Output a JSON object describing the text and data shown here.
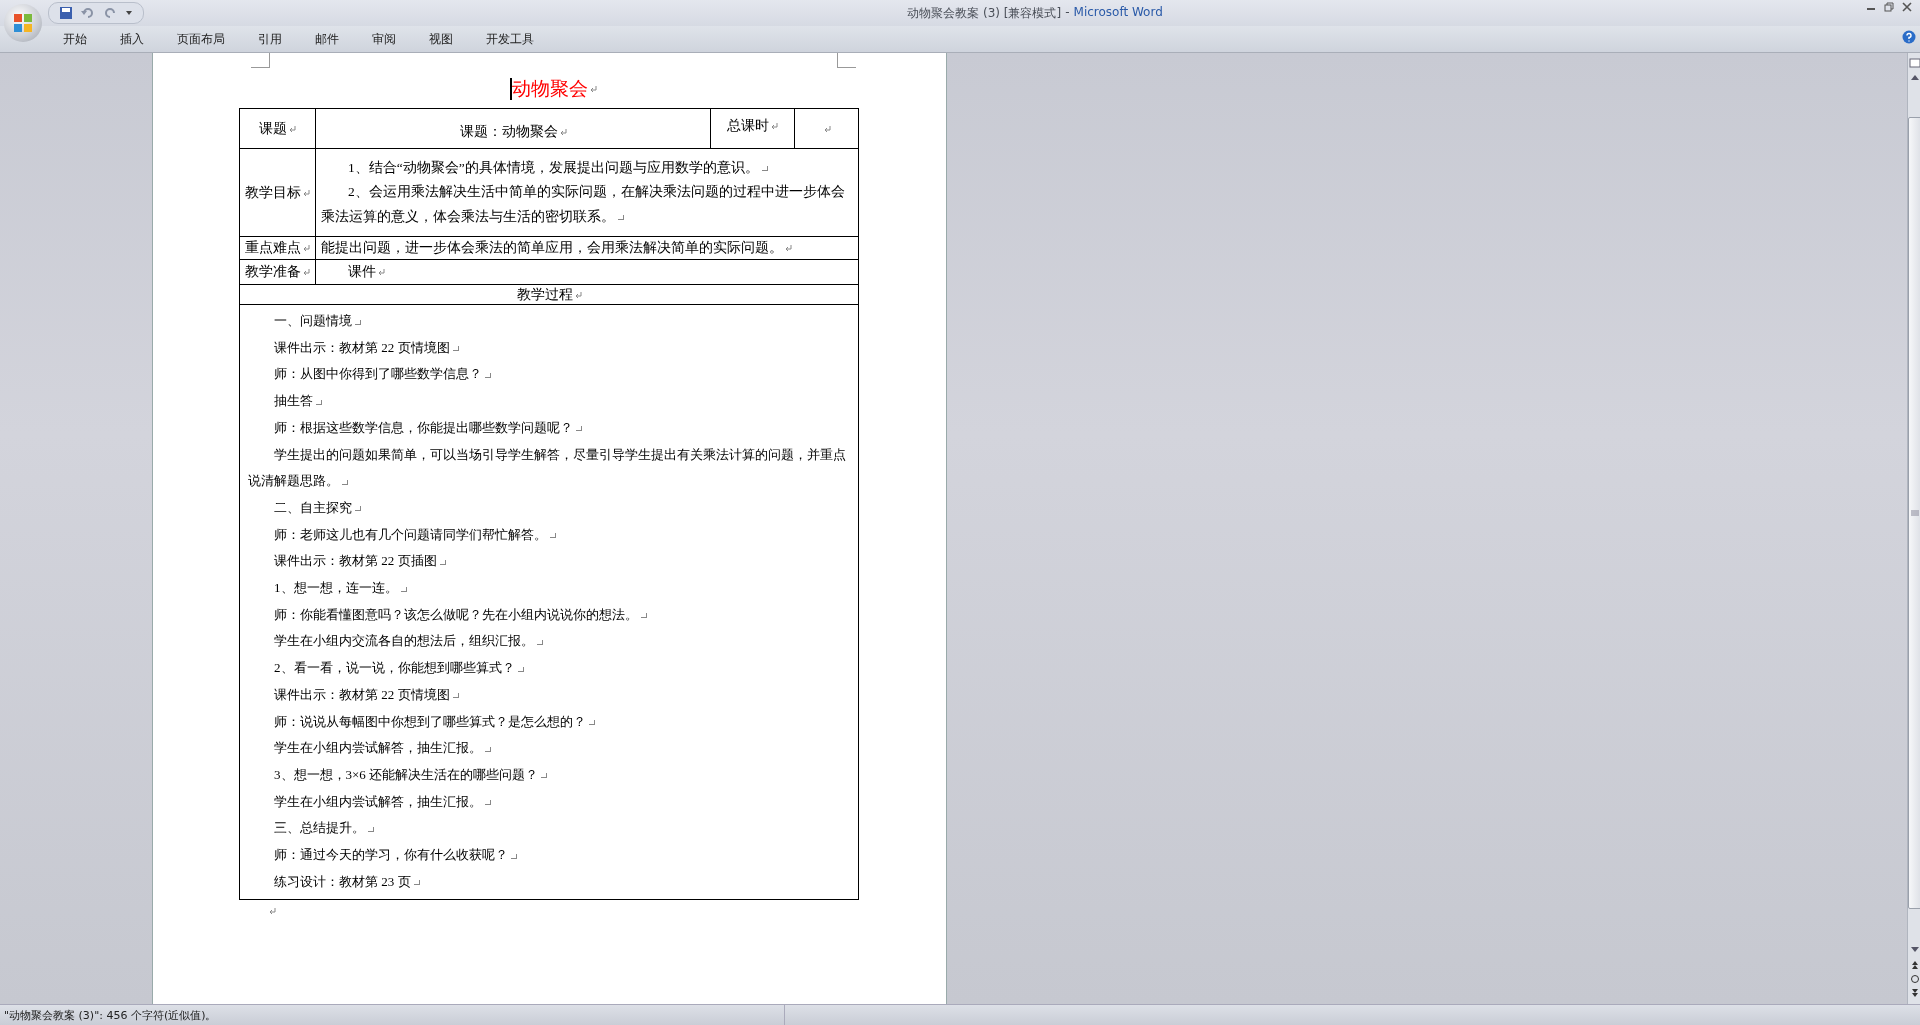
{
  "window": {
    "title": "动物聚会教案 (3) [兼容模式]",
    "separator": "-",
    "app": "Microsoft Word"
  },
  "ribbon_tabs": [
    {
      "label": "开始",
      "selected": false
    },
    {
      "label": "插入",
      "selected": false
    },
    {
      "label": "页面布局",
      "selected": false
    },
    {
      "label": "引用",
      "selected": false
    },
    {
      "label": "邮件",
      "selected": false
    },
    {
      "label": "审阅",
      "selected": false
    },
    {
      "label": "视图",
      "selected": false
    },
    {
      "label": "开发工具",
      "selected": false
    }
  ],
  "document": {
    "title": "动物聚会",
    "table": {
      "topic_row": {
        "label": "课题",
        "topic": "课题：动物聚会",
        "hours_label": "总课时"
      },
      "goals": {
        "label": "教学目标",
        "items": [
          "1、结合“动物聚会”的具体情境，发展提出问题与应用数学的意识。",
          "2、会运用乘法解决生活中简单的实际问题，在解决乘法问题的过程中进一步体会乘法运算的意义，体会乘法与生活的密切联系。"
        ]
      },
      "key_points": {
        "label": "重点难点",
        "text": "能提出问题，进一步体会乘法的简单应用，会用乘法解决简单的实际问题。"
      },
      "preparation": {
        "label": "教学准备",
        "text": "课件"
      },
      "process": {
        "heading": "教学过程",
        "paragraphs": [
          "一、问题情境",
          "课件出示：教材第 22 页情境图",
          "师：从图中你得到了哪些数学信息？",
          "抽生答",
          "师：根据这些数学信息，你能提出哪些数学问题呢？",
          "学生提出的问题如果简单，可以当场引导学生解答，尽量引导学生提出有关乘法计算的问题，并重点说清解题思路。",
          "二、自主探究",
          "师：老师这儿也有几个问题请同学们帮忙解答。",
          "课件出示：教材第 22 页插图",
          "1、想一想，连一连。",
          "师：你能看懂图意吗？该怎么做呢？先在小组内说说你的想法。",
          "学生在小组内交流各自的想法后，组织汇报。",
          "2、看一看，说一说，你能想到哪些算式？",
          "课件出示：教材第 22 页情境图",
          "师：说说从每幅图中你想到了哪些算式？是怎么想的？",
          "学生在小组内尝试解答，抽生汇报。",
          "3、想一想，3×6 还能解决生活在的哪些问题？",
          "学生在小组内尝试解答，抽生汇报。",
          "三、总结提升。",
          "师：通过今天的学习，你有什么收获呢？",
          "练习设计：教材第 23 页"
        ]
      }
    }
  },
  "status_bar": {
    "text": "\"动物聚会教案 (3)\": 456 个字符(近似值)。"
  }
}
